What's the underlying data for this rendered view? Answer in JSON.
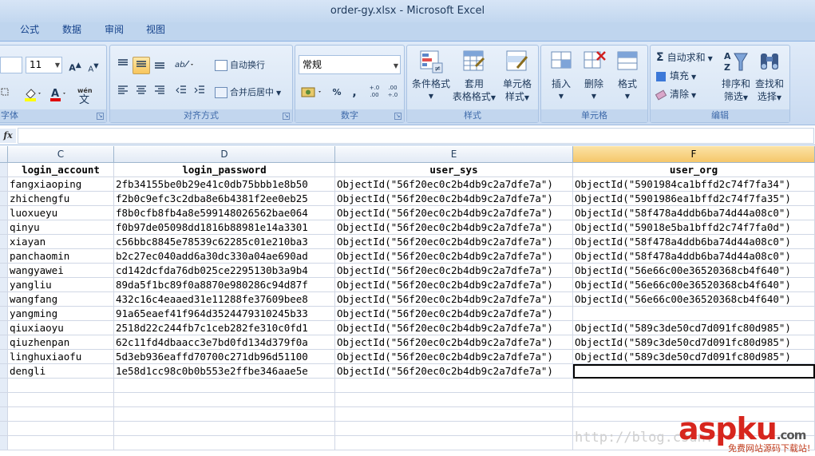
{
  "window": {
    "title": "order-gy.xlsx - Microsoft Excel"
  },
  "tabs": [
    "公式",
    "数据",
    "审阅",
    "视图"
  ],
  "ribbon": {
    "font_size": "11",
    "number_format": "常规",
    "groups": {
      "font": "字体",
      "alignment": "对齐方式",
      "number": "数字",
      "styles": "样式",
      "cells": "单元格",
      "editing": "编辑"
    },
    "alignment_buttons": {
      "wrap": "自动换行",
      "merge": "合并后居中"
    },
    "styles_buttons": {
      "conditional": "条件格式",
      "table_1": "套用",
      "table_2": "表格格式",
      "cell_1": "单元格",
      "cell_2": "样式"
    },
    "cells_buttons": {
      "insert": "插入",
      "delete": "删除",
      "format": "格式"
    },
    "editing_buttons": {
      "autosum": "自动求和",
      "fill": "填充",
      "clear": "清除",
      "sort_1": "排序和",
      "sort_2": "筛选",
      "find_1": "查找和",
      "find_2": "选择"
    },
    "percent": "%",
    "comma": ",",
    "inc_decimal": "+.0 .00",
    "dec_decimal": ".00 ÷.0"
  },
  "formula_bar": {
    "fx": "fx"
  },
  "columns": [
    "C",
    "D",
    "E",
    "F"
  ],
  "headers": [
    "login_account",
    "login_password",
    "user_sys",
    "user_org"
  ],
  "rows": [
    [
      "fangxiaoping",
      "2fb34155be0b29e41c0db75bbb1e8b50",
      "ObjectId(\"56f20ec0c2b4db9c2a7dfe7a\")",
      "ObjectId(\"5901984ca1bffd2c74f7fa34\")"
    ],
    [
      "zhichengfu",
      "f2b0c9efc3c2dba8e6b4381f2ee0eb25",
      "ObjectId(\"56f20ec0c2b4db9c2a7dfe7a\")",
      "ObjectId(\"5901986ea1bffd2c74f7fa35\")"
    ],
    [
      "luoxueyu",
      "f8b0cfb8fb4a8e599148026562bae064",
      "ObjectId(\"56f20ec0c2b4db9c2a7dfe7a\")",
      "ObjectId(\"58f478a4ddb6ba74d44a08c0\")"
    ],
    [
      "qinyu",
      "f0b97de05098dd1816b88981e14a3301",
      "ObjectId(\"56f20ec0c2b4db9c2a7dfe7a\")",
      "ObjectId(\"59018e5ba1bffd2c74f7fa0d\")"
    ],
    [
      "xiayan",
      "c56bbc8845e78539c62285c01e210ba3",
      "ObjectId(\"56f20ec0c2b4db9c2a7dfe7a\")",
      "ObjectId(\"58f478a4ddb6ba74d44a08c0\")"
    ],
    [
      "panchaomin",
      "b2c27ec040add6a30dc330a04ae690ad",
      "ObjectId(\"56f20ec0c2b4db9c2a7dfe7a\")",
      "ObjectId(\"58f478a4ddb6ba74d44a08c0\")"
    ],
    [
      "wangyawei",
      "cd142dcfda76db025ce2295130b3a9b4",
      "ObjectId(\"56f20ec0c2b4db9c2a7dfe7a\")",
      "ObjectId(\"56e66c00e36520368cb4f640\")"
    ],
    [
      "yangliu",
      "89da5f1bc89f0a8870e980286c94d87f",
      "ObjectId(\"56f20ec0c2b4db9c2a7dfe7a\")",
      "ObjectId(\"56e66c00e36520368cb4f640\")"
    ],
    [
      "wangfang",
      "432c16c4eaaed31e11288fe37609bee8",
      "ObjectId(\"56f20ec0c2b4db9c2a7dfe7a\")",
      "ObjectId(\"56e66c00e36520368cb4f640\")"
    ],
    [
      "yangming",
      "91a65eaef41f964d3524479310245b33",
      "ObjectId(\"56f20ec0c2b4db9c2a7dfe7a\")",
      ""
    ],
    [
      "qiuxiaoyu",
      "2518d22c244fb7c1ceb282fe310c0fd1",
      "ObjectId(\"56f20ec0c2b4db9c2a7dfe7a\")",
      "ObjectId(\"589c3de50cd7d091fc80d985\")"
    ],
    [
      "qiuzhenpan",
      "62c11fd4dbaacc3e7bd0fd134d379f0a",
      "ObjectId(\"56f20ec0c2b4db9c2a7dfe7a\")",
      "ObjectId(\"589c3de50cd7d091fc80d985\")"
    ],
    [
      "linghuxiaofu",
      "5d3eb936eaffd70700c271db96d51100",
      "ObjectId(\"56f20ec0c2b4db9c2a7dfe7a\")",
      "ObjectId(\"589c3de50cd7d091fc80d985\")"
    ],
    [
      "dengli",
      "1e58d1cc98c0b0b553e2ffbe346aae5e",
      "ObjectId(\"56f20ec0c2b4db9c2a7dfe7a\")",
      ""
    ]
  ],
  "watermark": "http://blog.csdn.",
  "logo": {
    "text": "aspku",
    "domain": ".com",
    "sub": "免费网站源码下载站!"
  }
}
